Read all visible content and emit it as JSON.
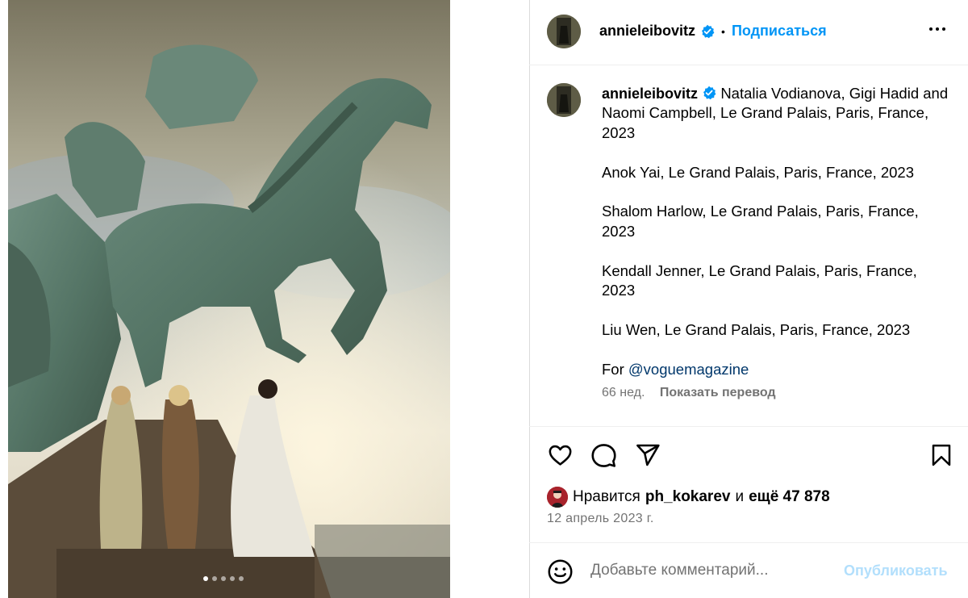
{
  "colors": {
    "accent": "#0095f6",
    "secondary_text": "#737373",
    "mention": "#00376b",
    "publish_disabled": "#b2dffc"
  },
  "photo": {
    "carousel_dots": 5,
    "active_dot": 0
  },
  "header": {
    "username": "annieleibovitz",
    "verified": true,
    "separator": "•",
    "follow_label": "Подписаться",
    "more_icon": "more-horizontal-icon"
  },
  "caption": {
    "username": "annieleibovitz",
    "first_line": "Natalia Vodianova, Gigi Hadid and Naomi Campbell, Le Grand Palais, Paris, France, 2023",
    "paragraphs": [
      "Anok Yai, Le Grand Palais, Paris, France, 2023",
      "Shalom Harlow, Le Grand Palais, Paris, France, 2023",
      "Kendall Jenner, Le Grand Palais, Paris, France, 2023",
      "Liu Wen, Le Grand Palais, Paris, France, 2023"
    ],
    "for_prefix": "For",
    "mention": "@voguemagazine",
    "age": "66 нед.",
    "translate_label": "Показать перевод"
  },
  "actions": {
    "like_icon": "heart-icon",
    "comment_icon": "comment-icon",
    "share_icon": "send-icon",
    "save_icon": "bookmark-icon"
  },
  "likes": {
    "prefix": "Нравится",
    "user": "ph_kokarev",
    "conj": "и",
    "rest": "ещё 47 878"
  },
  "date": "12 апрель 2023 г.",
  "comment": {
    "emoji_icon": "emoji-icon",
    "placeholder": "Добавьте комментарий...",
    "publish_label": "Опубликовать"
  }
}
